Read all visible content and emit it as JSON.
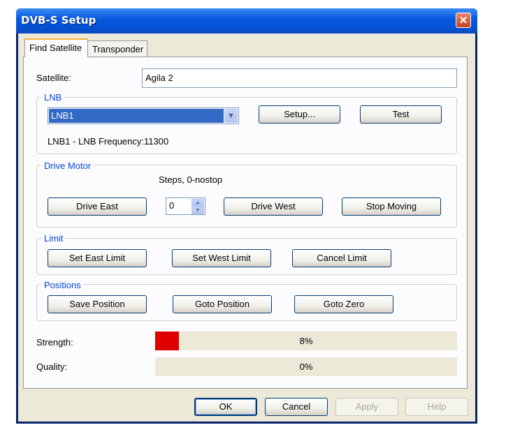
{
  "window": {
    "title": "DVB-S Setup",
    "close_glyph": "✕"
  },
  "tabs": [
    "Find Satellite",
    "Transponder"
  ],
  "satellite": {
    "label": "Satellite:",
    "value": "Agila 2"
  },
  "lnb": {
    "group_title": "LNB",
    "selected": "LNB1",
    "setup_label": "Setup...",
    "test_label": "Test",
    "info": "LNB1 - LNB Frequency:11300"
  },
  "drive_motor": {
    "group_title": "Drive Motor",
    "steps_label": "Steps, 0-nostop",
    "drive_east": "Drive East",
    "steps_value": "0",
    "drive_west": "Drive West",
    "stop_moving": "Stop Moving"
  },
  "limit": {
    "group_title": "Limit",
    "set_east": "Set East Limit",
    "set_west": "Set West Limit",
    "cancel": "Cancel Limit"
  },
  "positions": {
    "group_title": "Positions",
    "save": "Save Position",
    "goto": "Goto Position",
    "goto_zero": "Goto Zero"
  },
  "signal": {
    "strength_label": "Strength:",
    "strength_value": "8%",
    "strength_fraction": 0.08,
    "quality_label": "Quality:",
    "quality_value": "0%",
    "quality_fraction": 0
  },
  "footer": {
    "ok": "OK",
    "cancel": "Cancel",
    "apply": "Apply",
    "help": "Help"
  },
  "colors": {
    "titlebar": "#0a5ae0",
    "group_title": "#0046d5",
    "strength_fill": "#e00000",
    "selection": "#316ac5"
  },
  "icons": [
    "close-icon",
    "chevron-down-icon",
    "spin-up-icon",
    "spin-down-icon"
  ]
}
